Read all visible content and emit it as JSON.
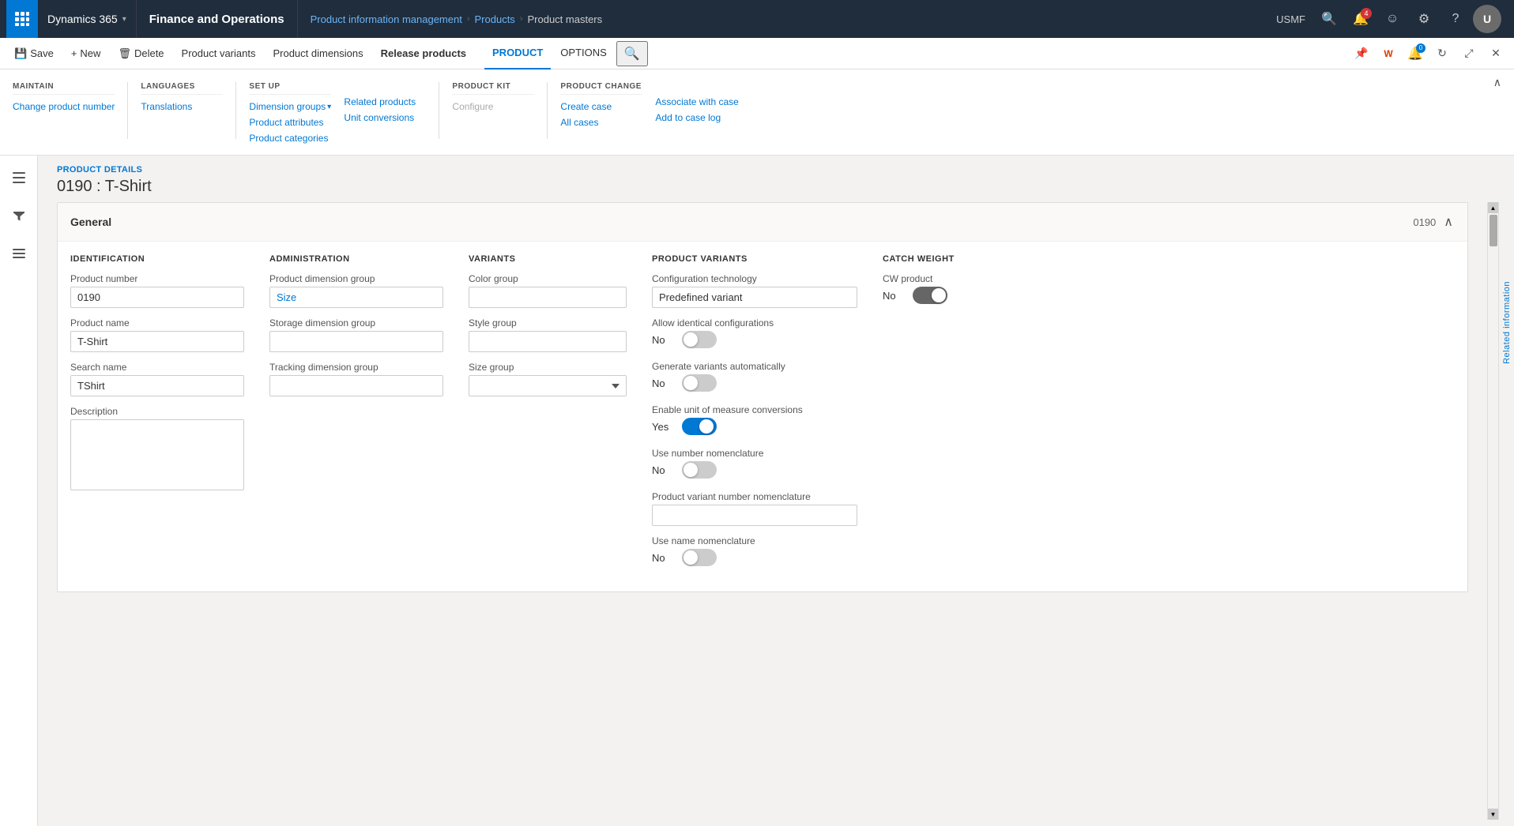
{
  "topNav": {
    "appGridIcon": "⊞",
    "dynamicsLabel": "Dynamics 365",
    "chevron": "∨",
    "finOpsLabel": "Finance and Operations",
    "breadcrumbs": [
      {
        "label": "Product information management",
        "link": true
      },
      {
        "label": "Products",
        "link": true
      },
      {
        "label": "Product masters",
        "link": false
      }
    ],
    "region": "USMF",
    "searchIcon": "🔍",
    "notifIcon": "🔔",
    "notifCount": "4",
    "smileyIcon": "☺",
    "settingsIcon": "⚙",
    "helpIcon": "?",
    "avatarInitial": "U"
  },
  "ribbon": {
    "saveLabel": "Save",
    "newLabel": "New",
    "deleteLabel": "Delete",
    "productVariantsLabel": "Product variants",
    "productDimensionsLabel": "Product dimensions",
    "releaseProductsLabel": "Release products",
    "tabs": [
      {
        "label": "PRODUCT",
        "active": true
      },
      {
        "label": "OPTIONS",
        "active": false
      }
    ],
    "searchIcon": "🔍"
  },
  "menuRibbon": {
    "sections": [
      {
        "id": "maintain",
        "title": "MAINTAIN",
        "items": [
          {
            "label": "Change product number",
            "disabled": false
          }
        ]
      },
      {
        "id": "languages",
        "title": "LANGUAGES",
        "items": [
          {
            "label": "Translations",
            "disabled": false
          }
        ]
      },
      {
        "id": "setup",
        "title": "SET UP",
        "items": [
          {
            "label": "Dimension groups",
            "hasArrow": true,
            "disabled": false
          },
          {
            "label": "Product attributes",
            "disabled": false
          },
          {
            "label": "Product categories",
            "disabled": false
          }
        ]
      },
      {
        "id": "relatedProducts",
        "title": "",
        "items": [
          {
            "label": "Related products",
            "disabled": false
          },
          {
            "label": "Unit conversions",
            "disabled": false
          }
        ]
      },
      {
        "id": "productKit",
        "title": "PRODUCT KIT",
        "items": [
          {
            "label": "Configure",
            "disabled": true
          }
        ]
      },
      {
        "id": "productChange",
        "title": "PRODUCT CHANGE",
        "items": [
          {
            "label": "Create case",
            "disabled": false
          },
          {
            "label": "All cases",
            "disabled": false
          }
        ]
      },
      {
        "id": "productChange2",
        "title": "",
        "items": [
          {
            "label": "Associate with case",
            "disabled": false
          },
          {
            "label": "Add to case log",
            "disabled": false
          }
        ]
      }
    ]
  },
  "productDetails": {
    "sectionLabel": "PRODUCT DETAILS",
    "title": "0190 : T-Shirt"
  },
  "general": {
    "sectionTitle": "General",
    "cardId": "0190",
    "identification": {
      "title": "IDENTIFICATION",
      "productNumber": {
        "label": "Product number",
        "value": "0190"
      },
      "productName": {
        "label": "Product name",
        "value": "T-Shirt"
      },
      "searchName": {
        "label": "Search name",
        "value": "TShirt"
      },
      "description": {
        "label": "Description",
        "value": ""
      }
    },
    "administration": {
      "title": "ADMINISTRATION",
      "productDimensionGroup": {
        "label": "Product dimension group",
        "value": "Size"
      },
      "storageDimensionGroup": {
        "label": "Storage dimension group",
        "value": ""
      },
      "trackingDimensionGroup": {
        "label": "Tracking dimension group",
        "value": ""
      }
    },
    "variants": {
      "title": "VARIANTS",
      "colorGroup": {
        "label": "Color group",
        "value": ""
      },
      "styleGroup": {
        "label": "Style group",
        "value": ""
      },
      "sizeGroup": {
        "label": "Size group",
        "value": ""
      }
    },
    "productVariants": {
      "title": "PRODUCT VARIANTS",
      "configurationTechnology": {
        "label": "Configuration technology",
        "value": "Predefined variant"
      },
      "allowIdenticalConfigurations": {
        "label": "Allow identical configurations",
        "statusLabel": "No",
        "enabled": false
      },
      "generateVariantsAutomatically": {
        "label": "Generate variants automatically",
        "statusLabel": "No",
        "enabled": false
      },
      "enableUnitOfMeasureConversions": {
        "label": "Enable unit of measure conversions",
        "statusLabel": "Yes",
        "enabled": true
      },
      "useNumberNomenclature": {
        "label": "Use number nomenclature",
        "statusLabel": "No",
        "enabled": false
      },
      "productVariantNumberNomenclature": {
        "label": "Product variant number nomenclature",
        "value": ""
      },
      "useNameNomenclature": {
        "label": "Use name nomenclature",
        "statusLabel": "No",
        "enabled": false
      }
    },
    "catchWeight": {
      "title": "CATCH WEIGHT",
      "cwProduct": {
        "label": "CW product",
        "statusLabel": "No",
        "enabled": false
      }
    }
  },
  "sidebar": {
    "filterIcon": "⊟",
    "listIcon": "≡"
  },
  "relatedInfoLabel": "Related information"
}
